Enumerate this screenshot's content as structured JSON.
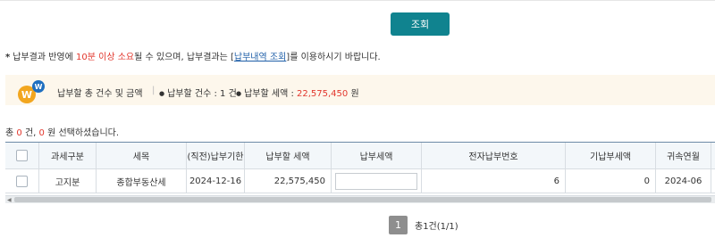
{
  "search_button": "조회",
  "notice": {
    "bullet": "*",
    "text_1": "납부결과 반영에",
    "highlight": "10분 이상 소요",
    "text_2": "될 수 있으며, 납부결과는 [",
    "link": "납부내역 조회",
    "text_3": "]를 이용하시기 바랍니다."
  },
  "summary": {
    "title": "납부할 총 건수 및 금액",
    "separator": "|",
    "count_label": "납부할 건수 : ",
    "count_value": "1",
    "count_unit": " 건",
    "amount_label": "납부할 세액 : ",
    "amount_value": "22,575,450",
    "amount_unit": " 원"
  },
  "selection": {
    "prefix": "총 ",
    "count": "0",
    "middle": " 건, ",
    "amount": "0",
    "suffix": " 원 선택하셨습니다."
  },
  "table": {
    "headers": {
      "tax_category": "과세구분",
      "tax_item": "세목",
      "due_date": "(직전)납부기한",
      "payable_amount": "납부할 세액",
      "payment_amount": "납부세액",
      "e_payment_number": "전자납부번호",
      "paid_amount": "기납부세액",
      "attribution_month": "귀속연월"
    },
    "rows": [
      {
        "tax_category": "고지분",
        "tax_item": "종합부동산세",
        "due_date": "2024-12-16",
        "payable_amount": "22,575,450",
        "payment_amount": "",
        "e_payment_number": "6",
        "paid_amount": "0",
        "attribution_month": "2024-06"
      }
    ]
  },
  "pagination": {
    "current_page": "1",
    "total_text": "총1건(1/1)"
  },
  "colors": {
    "primary": "#10838f",
    "highlight": "#e2372d",
    "link": "#1f5fa8",
    "summary_bg": "#fdf7ec"
  }
}
